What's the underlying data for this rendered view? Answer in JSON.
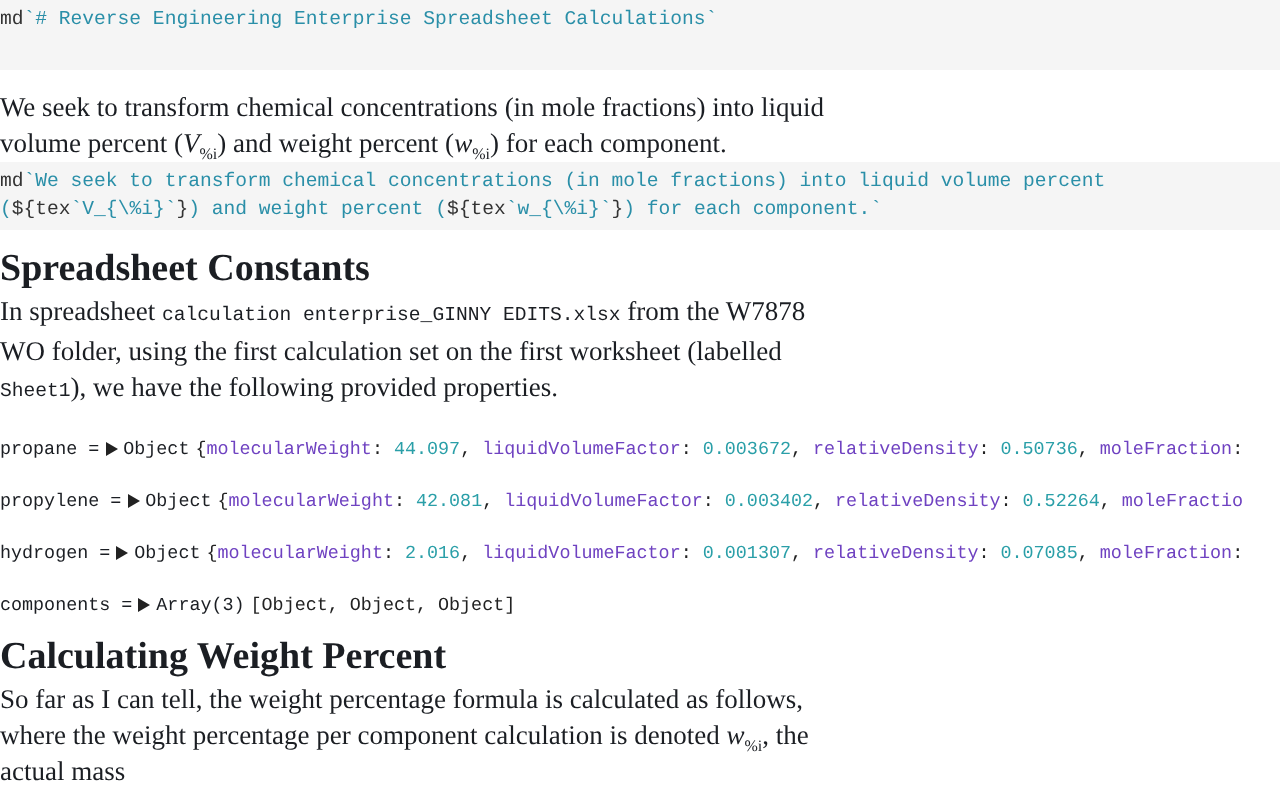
{
  "blocks": [
    {
      "kind": "code",
      "lines": [
        [
          {
            "kind": "keyword",
            "text": "md"
          },
          {
            "kind": "string",
            "text": "`# Reverse Engineering Enterprise Spreadsheet Calculations`"
          }
        ]
      ]
    },
    {
      "kind": "text",
      "text": "We seek to transform chemical concentrations (in mole fractions) into liquid volume percent (*V*$_{%i}$) and weight percent (*w*$_{%i}$) for each component."
    },
    {
      "kind": "code",
      "lines": [
        [
          {
            "kind": "keyword",
            "text": "md"
          },
          {
            "kind": "string",
            "text": "`We seek to transform chemical concentrations (in mole fractions) into liquid volume percent"
          }
        ],
        [
          {
            "kind": "string",
            "text": "("
          },
          {
            "kind": "keyword",
            "text": "${tex"
          },
          {
            "kind": "string",
            "text": "`V_{\\%i}`"
          },
          {
            "kind": "keyword",
            "text": "}"
          },
          {
            "kind": "string",
            "text": ") and weight percent ("
          },
          {
            "kind": "keyword",
            "text": "${tex"
          },
          {
            "kind": "string",
            "text": "`w_{\\%i}`"
          },
          {
            "kind": "keyword",
            "text": "}"
          },
          {
            "kind": "string",
            "text": ") for each component.`"
          }
        ]
      ]
    },
    {
      "kind": "heading",
      "text": "Spreadsheet Constants"
    },
    {
      "kind": "mixed",
      "parts": [
        {
          "code": false,
          "text": "In spreadsheet "
        },
        {
          "code": true,
          "text": "calculation enterprise_GINNY EDITS.xlsx"
        },
        {
          "code": false,
          "text": " from the W7878 WO folder, using the first calculation set on the first worksheet (labelled "
        },
        {
          "code": true,
          "text": "Sheet1"
        },
        {
          "code": false,
          "text": "), we have the following provided properties."
        }
      ]
    },
    {
      "kind": "inspector",
      "name": "propane =",
      "type": "Object",
      "tokens": [
        {
          "kind": "plain",
          "text": "{"
        },
        {
          "kind": "key",
          "text": "molecularWeight"
        },
        {
          "kind": "plain",
          "text": ": "
        },
        {
          "kind": "number",
          "text": "44.097"
        },
        {
          "kind": "plain",
          "text": ", "
        },
        {
          "kind": "key",
          "text": "liquidVolumeFactor"
        },
        {
          "kind": "plain",
          "text": ": "
        },
        {
          "kind": "number",
          "text": "0.003672"
        },
        {
          "kind": "plain",
          "text": ", "
        },
        {
          "kind": "key",
          "text": "relativeDensity"
        },
        {
          "kind": "plain",
          "text": ": "
        },
        {
          "kind": "number",
          "text": "0.50736"
        },
        {
          "kind": "plain",
          "text": ", "
        },
        {
          "kind": "key",
          "text": "moleFraction"
        },
        {
          "kind": "plain",
          "text": ":"
        }
      ]
    },
    {
      "kind": "inspector",
      "name": "propylene =",
      "type": "Object",
      "tokens": [
        {
          "kind": "plain",
          "text": "{"
        },
        {
          "kind": "key",
          "text": "molecularWeight"
        },
        {
          "kind": "plain",
          "text": ": "
        },
        {
          "kind": "number",
          "text": "42.081"
        },
        {
          "kind": "plain",
          "text": ", "
        },
        {
          "kind": "key",
          "text": "liquidVolumeFactor"
        },
        {
          "kind": "plain",
          "text": ": "
        },
        {
          "kind": "number",
          "text": "0.003402"
        },
        {
          "kind": "plain",
          "text": ", "
        },
        {
          "kind": "key",
          "text": "relativeDensity"
        },
        {
          "kind": "plain",
          "text": ": "
        },
        {
          "kind": "number",
          "text": "0.52264"
        },
        {
          "kind": "plain",
          "text": ", "
        },
        {
          "kind": "key",
          "text": "moleFractio"
        }
      ]
    },
    {
      "kind": "inspector",
      "name": "hydrogen =",
      "type": "Object",
      "tokens": [
        {
          "kind": "plain",
          "text": "{"
        },
        {
          "kind": "key",
          "text": "molecularWeight"
        },
        {
          "kind": "plain",
          "text": ": "
        },
        {
          "kind": "number",
          "text": "2.016"
        },
        {
          "kind": "plain",
          "text": ", "
        },
        {
          "kind": "key",
          "text": "liquidVolumeFactor"
        },
        {
          "kind": "plain",
          "text": ": "
        },
        {
          "kind": "number",
          "text": "0.001307"
        },
        {
          "kind": "plain",
          "text": ", "
        },
        {
          "kind": "key",
          "text": "relativeDensity"
        },
        {
          "kind": "plain",
          "text": ": "
        },
        {
          "kind": "number",
          "text": "0.07085"
        },
        {
          "kind": "plain",
          "text": ", "
        },
        {
          "kind": "key",
          "text": "moleFraction"
        },
        {
          "kind": "plain",
          "text": ":"
        }
      ]
    },
    {
      "kind": "inspector",
      "name": "components =",
      "type": "Array(3)",
      "tokens": [
        {
          "kind": "plain",
          "text": "[Object, Object, Object]"
        }
      ]
    },
    {
      "kind": "heading",
      "text": "Calculating Weight Percent"
    },
    {
      "kind": "text",
      "text": "So far as I can tell, the weight percentage formula is calculated as follows, where the weight percentage per component calculation is denoted *w*$_{%i}$, the actual mass"
    }
  ]
}
